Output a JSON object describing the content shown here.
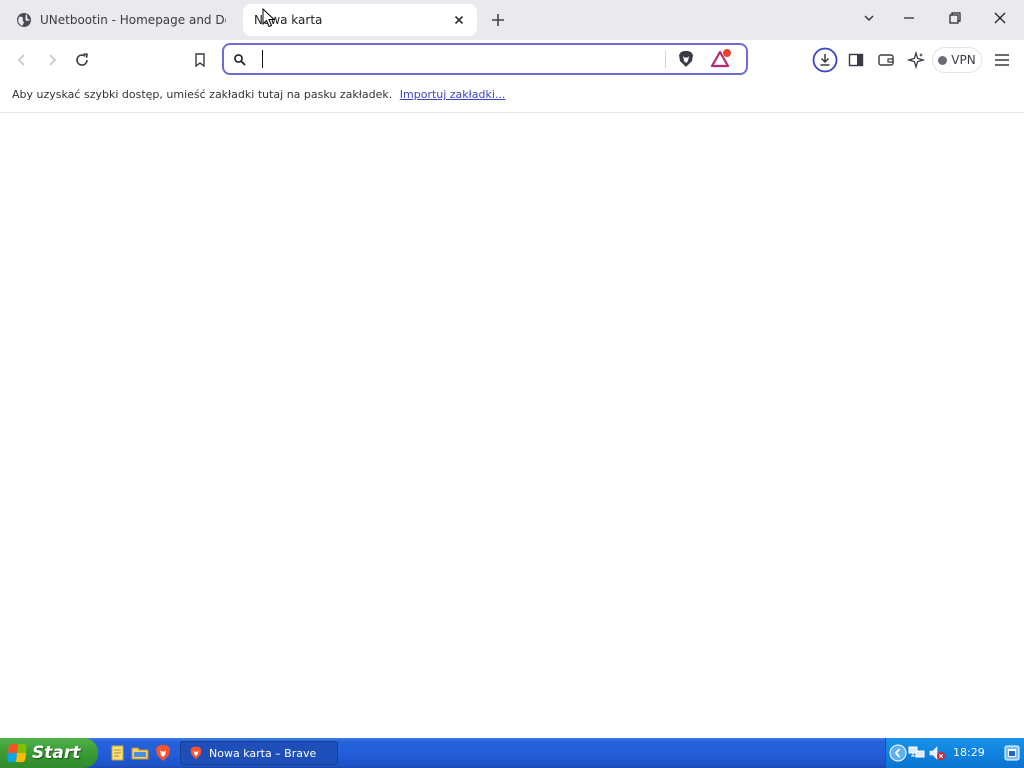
{
  "browser": {
    "tabs": [
      {
        "title": "UNetbootin - Homepage and Downloads",
        "active": false
      },
      {
        "title": "Nowa karta",
        "active": true
      }
    ],
    "address": {
      "value": "",
      "placeholder": ""
    },
    "vpn_label": "VPN",
    "bookmarks_bar": {
      "message": "Aby uzyskać szybki dostęp, umieść zakładki tutaj na pasku zakładek.",
      "import_link": "Importuj zakładki..."
    },
    "colors": {
      "accent": "#6e6bd9",
      "link": "#3b44c9"
    }
  },
  "taskbar": {
    "start_label": "Start",
    "task_item": "Nowa karta – Brave",
    "clock": "18:29"
  }
}
